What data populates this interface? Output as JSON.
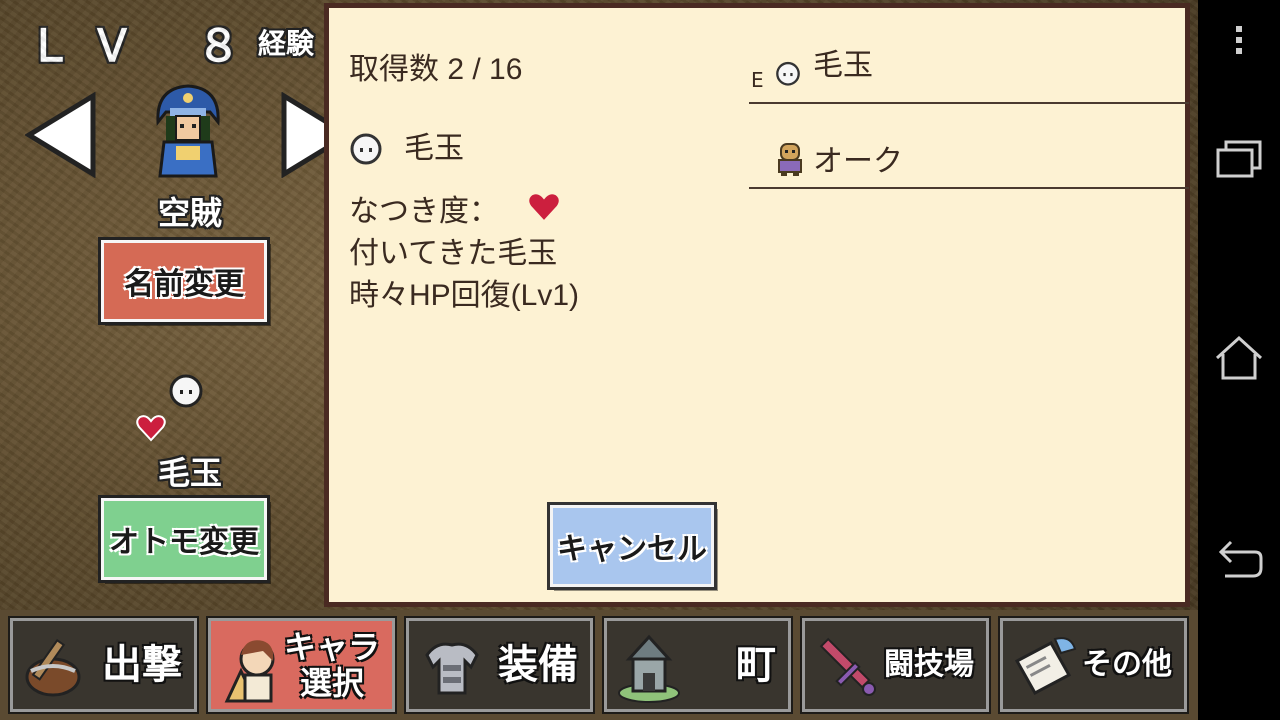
{
  "status": {
    "level": "ＬＶ ８",
    "exp_label": "経験"
  },
  "character": {
    "class_name": "空賊",
    "rename_button": "名前変更",
    "companion_name": "毛玉",
    "change_companion_button": "オトモ変更"
  },
  "dialog": {
    "count_text": "取得数 2 / 16",
    "selected_name": "毛玉",
    "affection_label": "なつき度：",
    "description_1": "付いてきた毛玉",
    "description_2": "時々HP回復(Lv1)",
    "cancel_button": "キャンセル",
    "list": [
      {
        "equip_mark": "E",
        "name": "毛玉",
        "icon": "furball-icon"
      },
      {
        "equip_mark": "",
        "name": "オーク",
        "icon": "orc-icon"
      }
    ]
  },
  "nav": [
    {
      "label": "出撃",
      "icon": "sortie-icon",
      "active": false
    },
    {
      "label": "キャラ選択",
      "line1": "キャラ",
      "line2": "選択",
      "icon": "character-icon",
      "active": true
    },
    {
      "label": "装備",
      "icon": "armor-icon",
      "active": false
    },
    {
      "label": "町",
      "icon": "town-icon",
      "active": false
    },
    {
      "label": "闘技場",
      "icon": "sword-icon",
      "active": false
    },
    {
      "label": "その他",
      "icon": "scroll-icon",
      "active": false
    }
  ],
  "colors": {
    "dialog_bg": "#fdf2d3",
    "heart": "#cc1f3e",
    "rename_button": "#d56a55",
    "companion_button": "#7fd08f",
    "cancel_button": "#a9c6ee",
    "active_tab": "#d96a5f"
  }
}
